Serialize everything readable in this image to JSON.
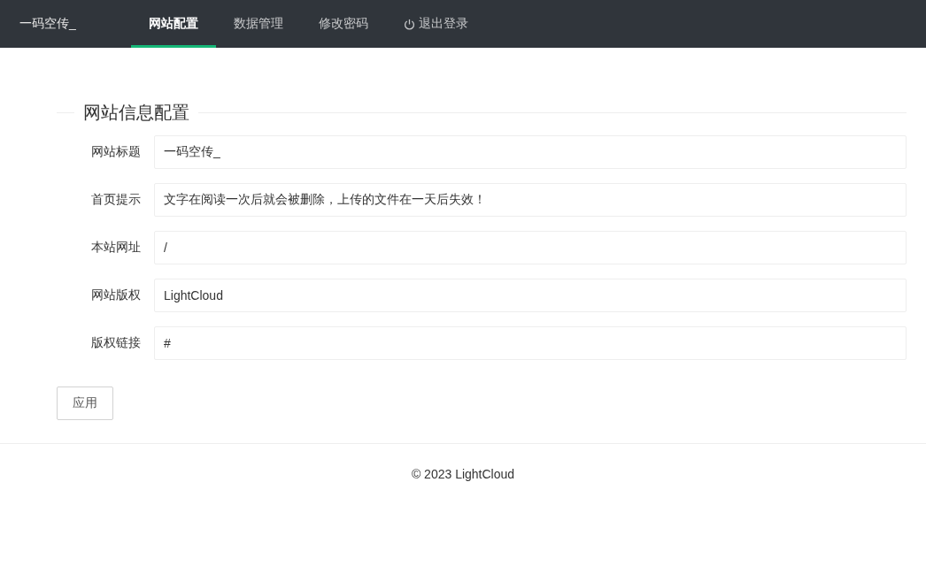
{
  "header": {
    "logo": "一码空传_",
    "nav": [
      {
        "label": "网站配置",
        "selected": true,
        "kind": "link"
      },
      {
        "label": "数据管理",
        "selected": false,
        "kind": "link"
      },
      {
        "label": "修改密码",
        "selected": false,
        "kind": "link"
      },
      {
        "label": "退出登录",
        "selected": false,
        "kind": "logout"
      }
    ]
  },
  "form": {
    "legend": "网站信息配置",
    "fields": [
      {
        "label": "网站标题",
        "value": "一码空传_"
      },
      {
        "label": "首页提示",
        "value": "文字在阅读一次后就会被删除，上传的文件在一天后失效！"
      },
      {
        "label": "本站网址",
        "value": "/"
      },
      {
        "label": "网站版权",
        "value": "LightCloud"
      },
      {
        "label": "版权链接",
        "value": "#"
      }
    ],
    "submit": "应用"
  },
  "footer": "© 2023 LightCloud"
}
